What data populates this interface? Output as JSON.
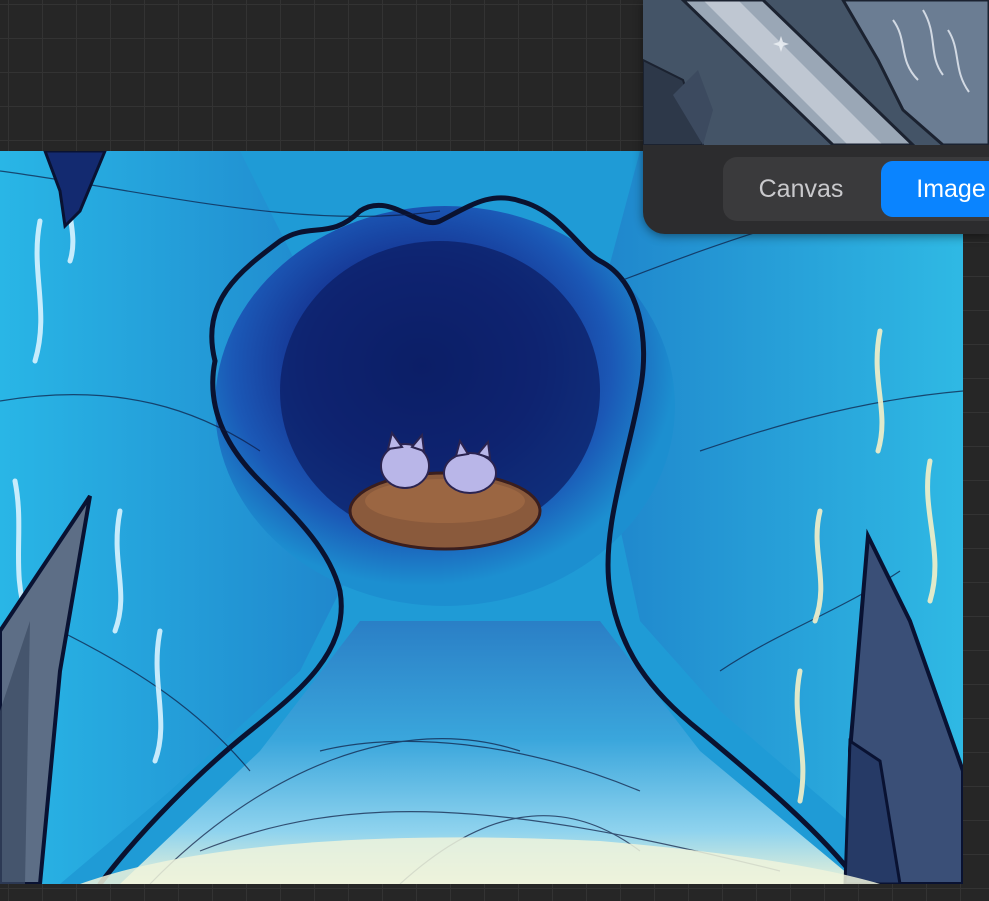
{
  "reference_panel": {
    "tabs": [
      {
        "label": "Canvas",
        "selected": false
      },
      {
        "label": "Image",
        "selected": true
      }
    ],
    "accent_color": "#0a84ff"
  },
  "artwork": {
    "description_icon": "cave-painting"
  }
}
